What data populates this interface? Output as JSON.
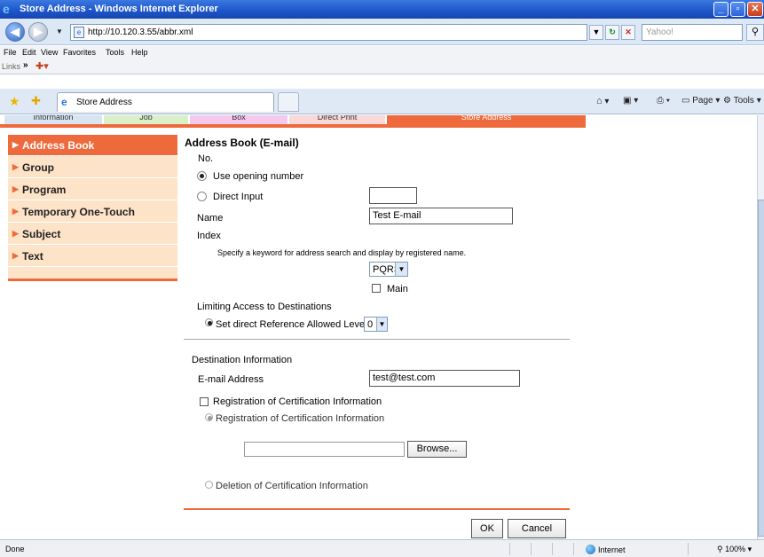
{
  "window": {
    "title": "Store Address - Windows Internet Explorer"
  },
  "address": {
    "url": "http://10.120.3.55/abbr.xml",
    "search_placeholder": "Yahoo!"
  },
  "menu": {
    "items": [
      "File",
      "Edit",
      "View",
      "Favorites",
      "Tools",
      "Help"
    ]
  },
  "links": {
    "label": "Links"
  },
  "tab": {
    "label": "Store Address"
  },
  "commands": {
    "page": "Page",
    "tools": "Tools"
  },
  "top_tabs": [
    "Information",
    "Job",
    "Box",
    "Direct Print",
    "Store Address"
  ],
  "sidebar": {
    "items": [
      {
        "label": "Address Book"
      },
      {
        "label": "Group"
      },
      {
        "label": "Program"
      },
      {
        "label": "Temporary One-Touch"
      },
      {
        "label": "Subject"
      },
      {
        "label": "Text"
      }
    ]
  },
  "form": {
    "heading": "Address Book (E-mail)",
    "no_label": "No.",
    "use_opening_number": "Use opening number",
    "direct_input": "Direct Input",
    "direct_input_value": "",
    "name_label": "Name",
    "name_value": "Test E-mail",
    "index_label": "Index",
    "index_hint": "Specify a keyword for address search and display by registered name.",
    "index_selected": "PQRS",
    "main_label": "Main",
    "limiting_label": "Limiting Access to Destinations",
    "set_reference_label": "Set direct Reference Allowed Level",
    "reference_level": "0",
    "destination_label": "Destination Information",
    "email_label": "E-mail Address",
    "email_value": "test@test.com",
    "reg_cert_check": "Registration of Certification Information",
    "reg_cert_radio": "Registration of Certification Information",
    "browse_label": "Browse...",
    "delete_cert_radio": "Deletion of Certification Information",
    "ok_label": "OK",
    "cancel_label": "Cancel"
  },
  "status": {
    "left": "Done",
    "zone": "Internet",
    "zoom": "100%"
  }
}
